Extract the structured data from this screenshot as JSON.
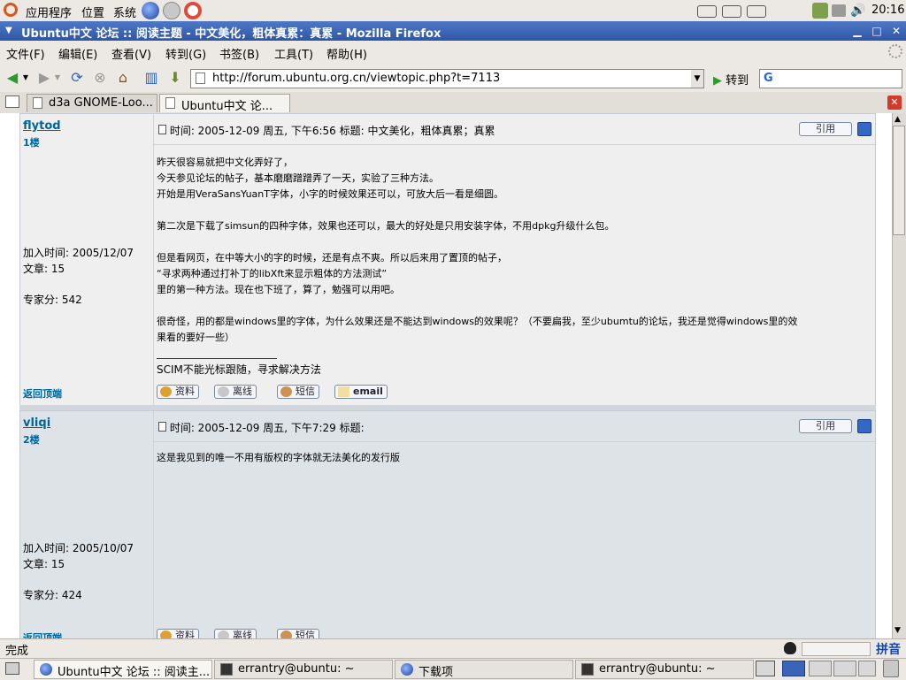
{
  "colors": {
    "title_bar": "#3a64b7",
    "link": "#006699",
    "post_bg": "#efefef",
    "post_alt_bg": "#dee3e7"
  },
  "top_panel": {
    "menus": [
      "应用程序",
      "位置",
      "系统"
    ],
    "clock": "20:16"
  },
  "window": {
    "title": "Ubuntu中文 论坛 :: 阅读主题 - 中文美化，粗体真累：真累 - Mozilla Firefox"
  },
  "menubar": [
    "文件(F)",
    "编辑(E)",
    "查看(V)",
    "转到(G)",
    "书签(B)",
    "工具(T)",
    "帮助(H)"
  ],
  "toolbar": {
    "url": "http://forum.ubuntu.org.cn/viewtopic.php?t=7113",
    "go_label": "转到",
    "search_value": ""
  },
  "tabs": [
    {
      "label": "d3a GNOME-Loo...",
      "active": false
    },
    {
      "label": "Ubuntu中文 论...",
      "active": true
    }
  ],
  "posts": [
    {
      "username": "flytod",
      "floor": "1楼",
      "joined": "加入时间: 2005/12/07",
      "articles": "文章: 15",
      "score": "专家分: 542",
      "header": "时间: 2005-12-09 周五, 下午6:56   标题: 中文美化，粗体真累；真累",
      "quote_label": "引用",
      "lines": [
        "昨天很容易就把中文化弄好了，",
        "今天参见论坛的帖子，基本磨磨蹭蹭弄了一天，实验了三种方法。",
        "开始是用VeraSansYuanT字体，小字的时候效果还可以，可放大后一看是细圆。",
        "",
        "第二次是下载了simsun的四种字体，效果也还可以，最大的好处是只用安装字体，不用dpkg升级什么包。",
        "",
        "但是看网页，在中等大小的字的时候，还是有点不爽。所以后来用了置顶的帖子，",
        "“寻求两种通过打补丁的libXft来显示粗体的方法测试”",
        "里的第一种方法。现在也下班了，算了，勉强可以用吧。",
        "",
        "很奇怪，用的都是windows里的字体，为什么效果还是不能达到windows的效果呢？（不要扁我，至少ubumtu的论坛，我还是觉得windows里的效",
        "果看的要好一些）"
      ],
      "signature": "SCIM不能光标跟随，寻求解决方法",
      "back_top": "返回顶端",
      "buttons": [
        "资料",
        "离线",
        "短信",
        "email"
      ]
    },
    {
      "username": "vliqi",
      "floor": "2楼",
      "joined": "加入时间: 2005/10/07",
      "articles": "文章: 15",
      "score": "专家分: 424",
      "header": "时间: 2005-12-09 周五, 下午7:29   标题:",
      "quote_label": "引用",
      "lines": [
        "这是我见到的唯一不用有版权的字体就无法美化的发行版"
      ],
      "back_top": "返回顶端",
      "buttons": [
        "资料",
        "离线",
        "短信"
      ]
    }
  ],
  "statusbar": {
    "text": "完成",
    "ime": "拼音"
  },
  "taskbar": [
    "Ubuntu中文 论坛 :: 阅读主...",
    "errantry@ubuntu: ~",
    "下载项",
    "errantry@ubuntu: ~"
  ]
}
